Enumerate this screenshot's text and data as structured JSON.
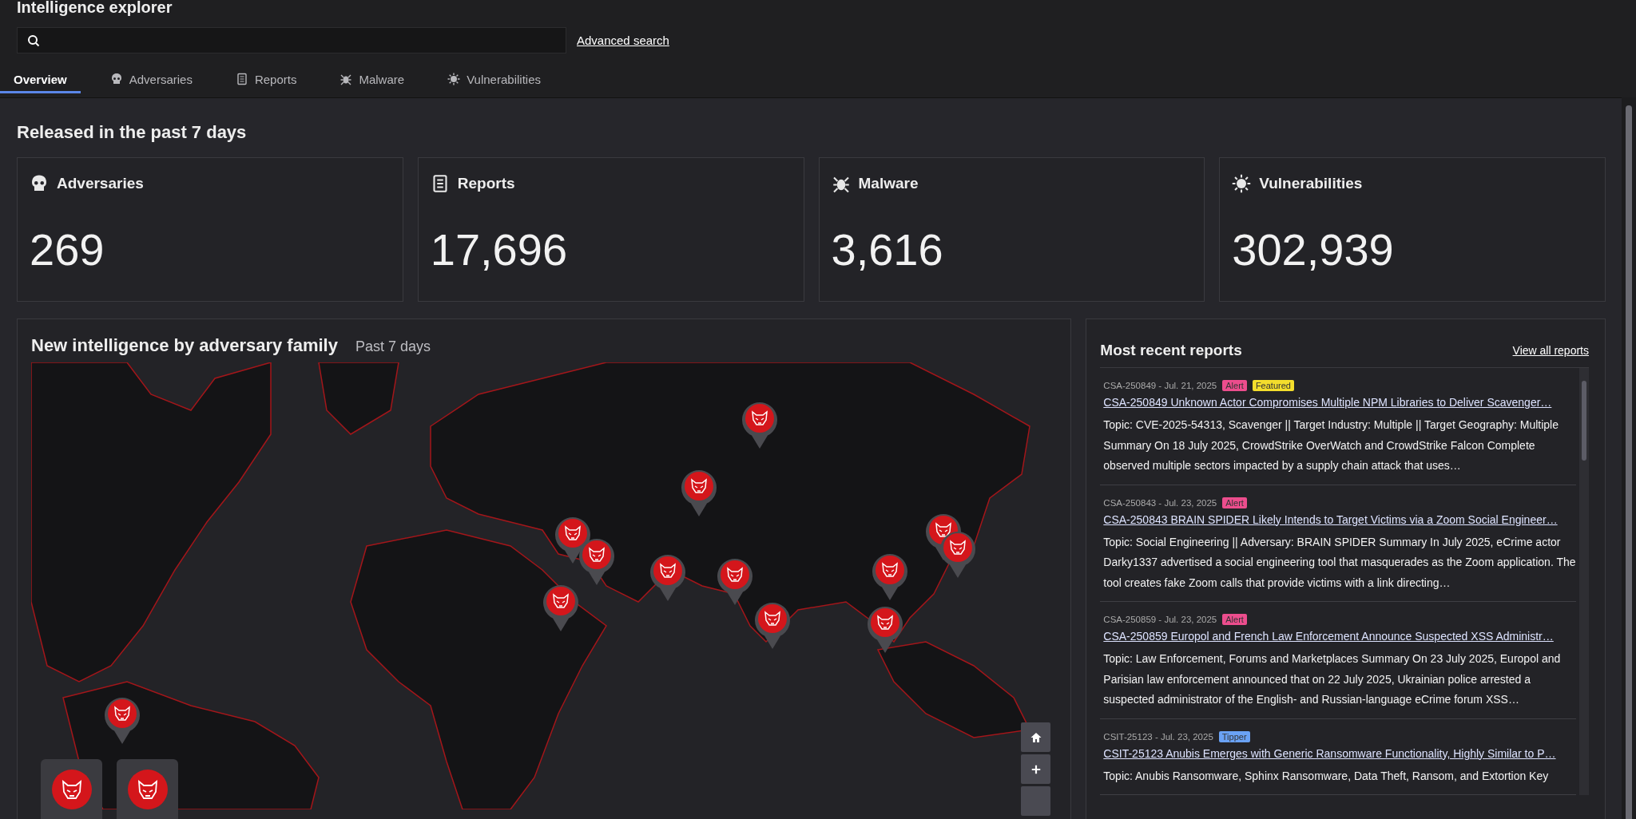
{
  "header": {
    "title": "Intelligence explorer",
    "advanced_search": "Advanced search"
  },
  "tabs": [
    {
      "label": "Overview",
      "selected": true
    },
    {
      "label": "Adversaries",
      "selected": false
    },
    {
      "label": "Reports",
      "selected": false
    },
    {
      "label": "Malware",
      "selected": false
    },
    {
      "label": "Vulnerabilities",
      "selected": false
    }
  ],
  "section_title": "Released in the past 7 days",
  "stats": [
    {
      "label": "Adversaries",
      "value": "269"
    },
    {
      "label": "Reports",
      "value": "17,696"
    },
    {
      "label": "Malware",
      "value": "3,616"
    },
    {
      "label": "Vulnerabilities",
      "value": "302,939"
    }
  ],
  "map_panel": {
    "title": "New intelligence by adversary family",
    "subtitle": "Past 7 days"
  },
  "reports_panel": {
    "title": "Most recent reports",
    "view_all": "View all reports",
    "reports": [
      {
        "meta": "CSA-250849 - Jul. 21, 2025",
        "badges": [
          {
            "label": "Alert",
            "kind": "alert"
          },
          {
            "label": "Featured",
            "kind": "featured"
          }
        ],
        "title": "CSA-250849 Unknown Actor Compromises Multiple NPM Libraries to Deliver Scavenger…",
        "body": "Topic: CVE-2025-54313, Scavenger || Target Industry: Multiple || Target Geography: Multiple Summary On 18 July 2025, CrowdStrike OverWatch and CrowdStrike Falcon Complete observed multiple sectors impacted by a supply chain attack that uses…"
      },
      {
        "meta": "CSA-250843 - Jul. 23, 2025",
        "badges": [
          {
            "label": "Alert",
            "kind": "alert"
          }
        ],
        "title": "CSA-250843 BRAIN SPIDER Likely Intends to Target Victims via a Zoom Social Engineer…",
        "body": "Topic: Social Engineering || Adversary: BRAIN SPIDER Summary In July 2025, eCrime actor Darky1337 advertised a social engineering tool that masquerades as the Zoom application. The tool creates fake Zoom calls that provide victims with a link directing…"
      },
      {
        "meta": "CSA-250859 - Jul. 23, 2025",
        "badges": [
          {
            "label": "Alert",
            "kind": "alert"
          }
        ],
        "title": "CSA-250859 Europol and French Law Enforcement Announce Suspected XSS Administr…",
        "body": "Topic: Law Enforcement, Forums and Marketplaces Summary On 23 July 2025, Europol and Parisian law enforcement announced that on 22 July 2025, Ukrainian police arrested a suspected administrator of the English- and Russian-language eCrime forum XSS…"
      },
      {
        "meta": "CSIT-25123 - Jul. 23, 2025",
        "badges": [
          {
            "label": "Tipper",
            "kind": "tipper"
          }
        ],
        "title": "CSIT-25123 Anubis Emerges with Generic Ransomware Functionality, Highly Similar to P…",
        "body": "Topic: Anubis Ransomware, Sphinx Ransomware, Data Theft, Ransom, and Extortion Key"
      }
    ]
  }
}
